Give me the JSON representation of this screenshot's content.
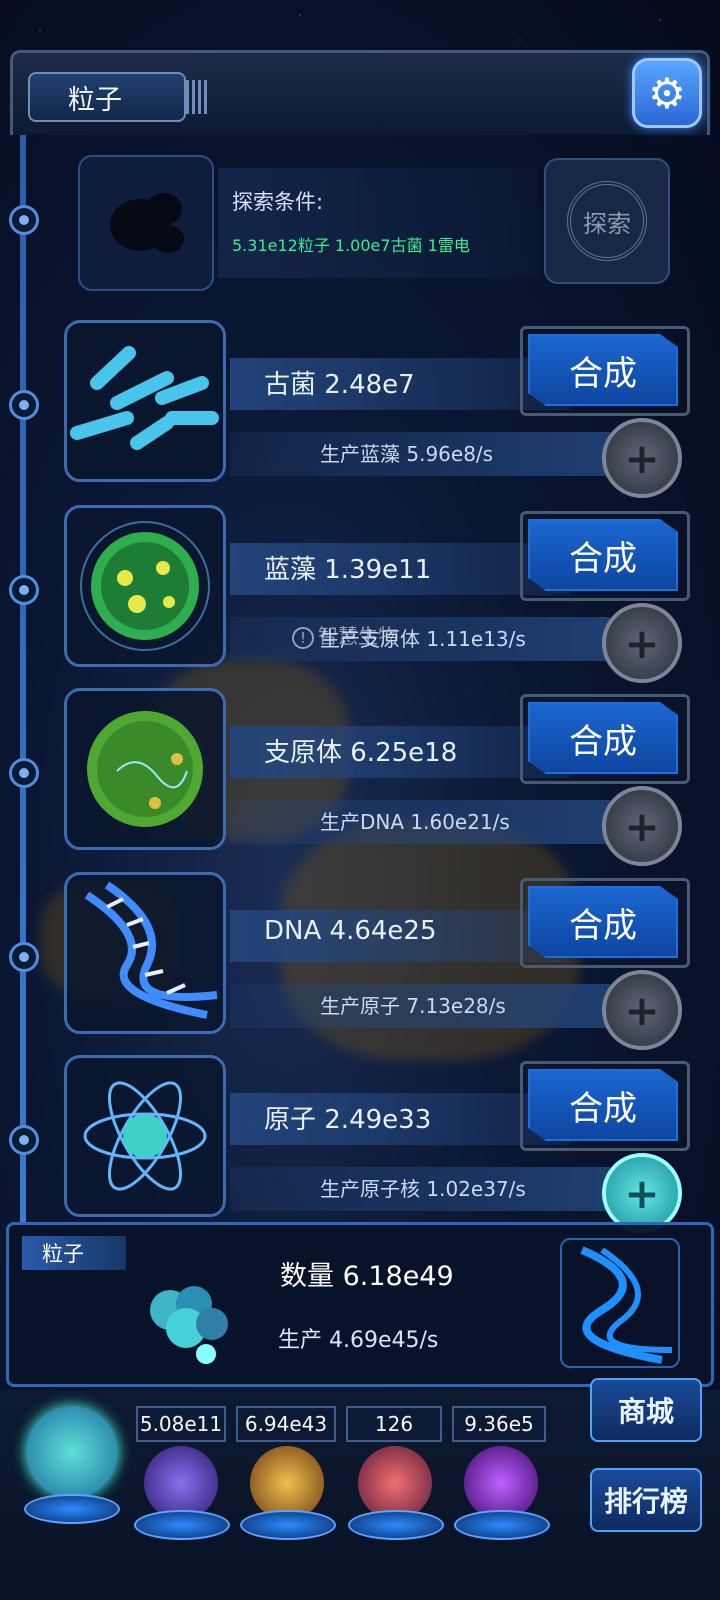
{
  "header": {
    "title": "粒子"
  },
  "explore": {
    "label": "探索条件:",
    "requirement": "5.31e12粒子 1.00e7古菌 1雷电",
    "button_label": "探索"
  },
  "rows": [
    {
      "name": "古菌 2.48e7",
      "prod": "生产蓝藻 5.96e8/s",
      "merge_label": "合成",
      "icon": "archaea-icon"
    },
    {
      "name": "蓝藻 1.39e11",
      "prod": "生产支原体 1.11e13/s",
      "merge_label": "合成",
      "icon": "cyanobacteria-icon"
    },
    {
      "name": "支原体 6.25e18",
      "prod": "生产DNA 1.60e21/s",
      "merge_label": "合成",
      "icon": "mycoplasma-icon"
    },
    {
      "name": "DNA 4.64e25",
      "prod": "生产原子 7.13e28/s",
      "merge_label": "合成",
      "icon": "dna-icon"
    },
    {
      "name": "原子 2.49e33",
      "prod": "生产原子核 1.02e37/s",
      "merge_label": "合成",
      "icon": "atom-icon"
    }
  ],
  "toast": {
    "text": "智慧生物"
  },
  "bottom": {
    "tag": "粒子",
    "count": "数量 6.18e49",
    "production": "生产 4.69e45/s"
  },
  "resources": [
    {
      "value": "5.08e11",
      "icon": "lightning-orb-icon",
      "color": "#5a3fbf"
    },
    {
      "value": "6.94e43",
      "icon": "fire-orb-icon",
      "color": "#b8741e"
    },
    {
      "value": "126",
      "icon": "brain-orb-icon",
      "color": "#b03a5a"
    },
    {
      "value": "9.36e5",
      "icon": "portal-orb-icon",
      "color": "#7a2ad0"
    }
  ],
  "buttons": {
    "shop": "商城",
    "rank": "排行榜"
  }
}
